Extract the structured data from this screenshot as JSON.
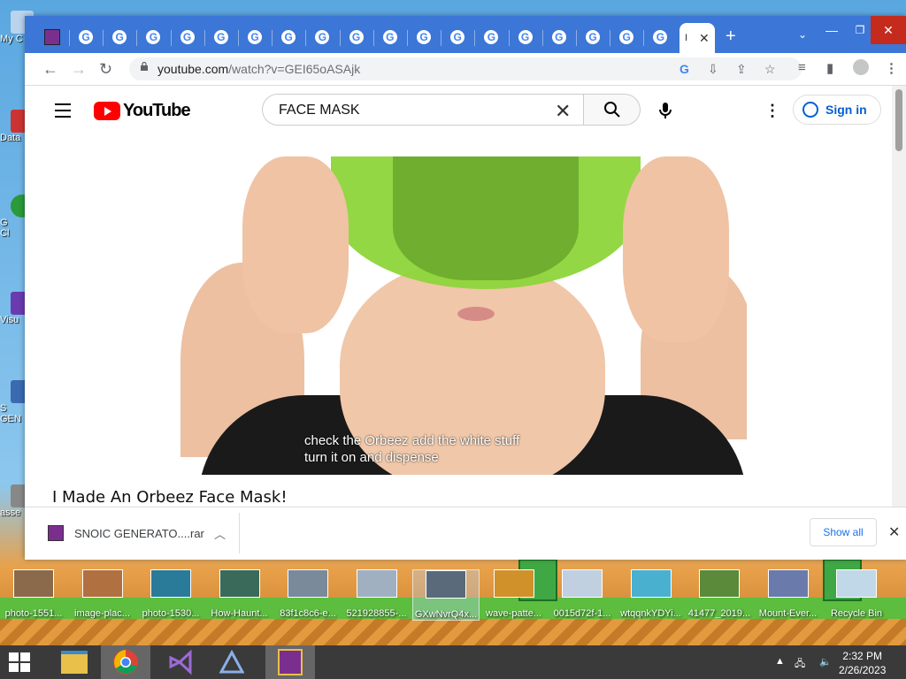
{
  "desktop": {
    "left_icons": [
      "My C",
      "Data",
      "G\nCl",
      "Visu",
      "S\nGEN",
      "asse"
    ],
    "bottom_icons": [
      {
        "label": "photo-1551...",
        "color": "#8a6a4a"
      },
      {
        "label": "image-plac...",
        "color": "#b07040"
      },
      {
        "label": "photo-1530...",
        "color": "#2a7a9a"
      },
      {
        "label": "How-Haunt...",
        "color": "#3a6a5a"
      },
      {
        "label": "83f1c8c6-e...",
        "color": "#7a8a9a"
      },
      {
        "label": "521928855-...",
        "color": "#a0b0c0"
      },
      {
        "label": "GXwNvrQ4x...",
        "color": "#5a6a7a"
      },
      {
        "label": "wave-patte...",
        "color": "#d0902a"
      },
      {
        "label": "0015d72f-1...",
        "color": "#c0d0e0"
      },
      {
        "label": "wtqqnkYDYi...",
        "color": "#4ab0d0"
      },
      {
        "label": "41477_2019...",
        "color": "#5a8a3a"
      },
      {
        "label": "Mount-Ever...",
        "color": "#6a7aaa"
      },
      {
        "label": "Recycle Bin",
        "color": "#c0d8e8"
      }
    ]
  },
  "browser": {
    "active_tab_title": "I",
    "tab_count": 19,
    "url_domain": "youtube.com",
    "url_path": "/watch?v=GEI65oASAjk"
  },
  "youtube": {
    "logo_text": "YouTube",
    "search_value": "FACE MASK",
    "sign_in": "Sign in",
    "caption_line1": "check the Orbeez add the white stuff",
    "caption_line2": "turn it on and dispense",
    "video_title": "I Made An Orbeez Face Mask!"
  },
  "downloads": {
    "file_name": "SNOIC GENERATO....rar",
    "show_all": "Show all"
  },
  "taskbar": {
    "time": "2:32 PM",
    "date": "2/26/2023"
  },
  "colors": {
    "tabstrip": "#3c76d6",
    "yt_red": "#ff0000",
    "link_blue": "#065fd4"
  }
}
